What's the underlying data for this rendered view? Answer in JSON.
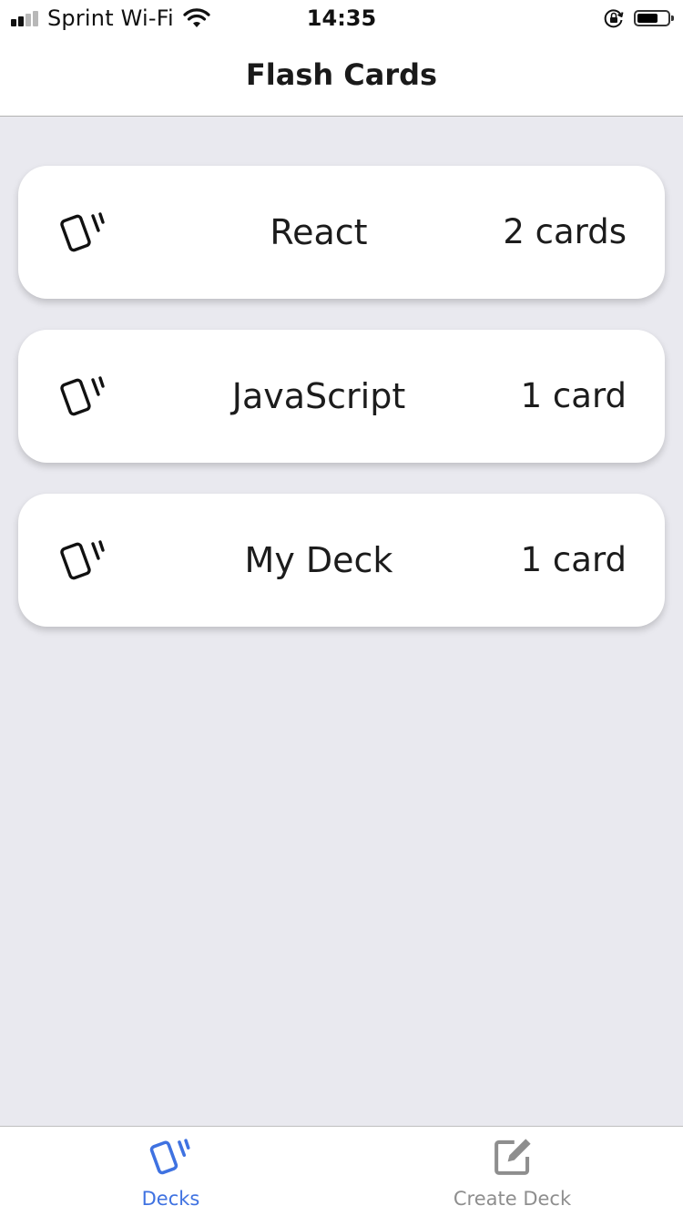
{
  "status_bar": {
    "carrier": "Sprint Wi-Fi",
    "time": "14:35",
    "signal_bars_filled": 2,
    "signal_bars_total": 4,
    "battery_level": 0.7,
    "icons": [
      "signal-icon",
      "wifi-icon",
      "orientation-lock-icon",
      "battery-icon"
    ]
  },
  "header": {
    "title": "Flash Cards"
  },
  "decks": [
    {
      "name": "React",
      "count": "2 cards",
      "icon": "cards-icon"
    },
    {
      "name": "JavaScript",
      "count": "1 card",
      "icon": "cards-icon"
    },
    {
      "name": "My Deck",
      "count": "1 card",
      "icon": "cards-icon"
    }
  ],
  "tabs": [
    {
      "label": "Decks",
      "icon": "cards-icon",
      "active": true
    },
    {
      "label": "Create Deck",
      "icon": "edit-icon",
      "active": false
    }
  ],
  "colors": {
    "accent": "#3f72e1",
    "inactive": "#8e8e8e",
    "background": "#e9e9ef",
    "card": "#ffffff",
    "text": "#1c1c1c"
  }
}
